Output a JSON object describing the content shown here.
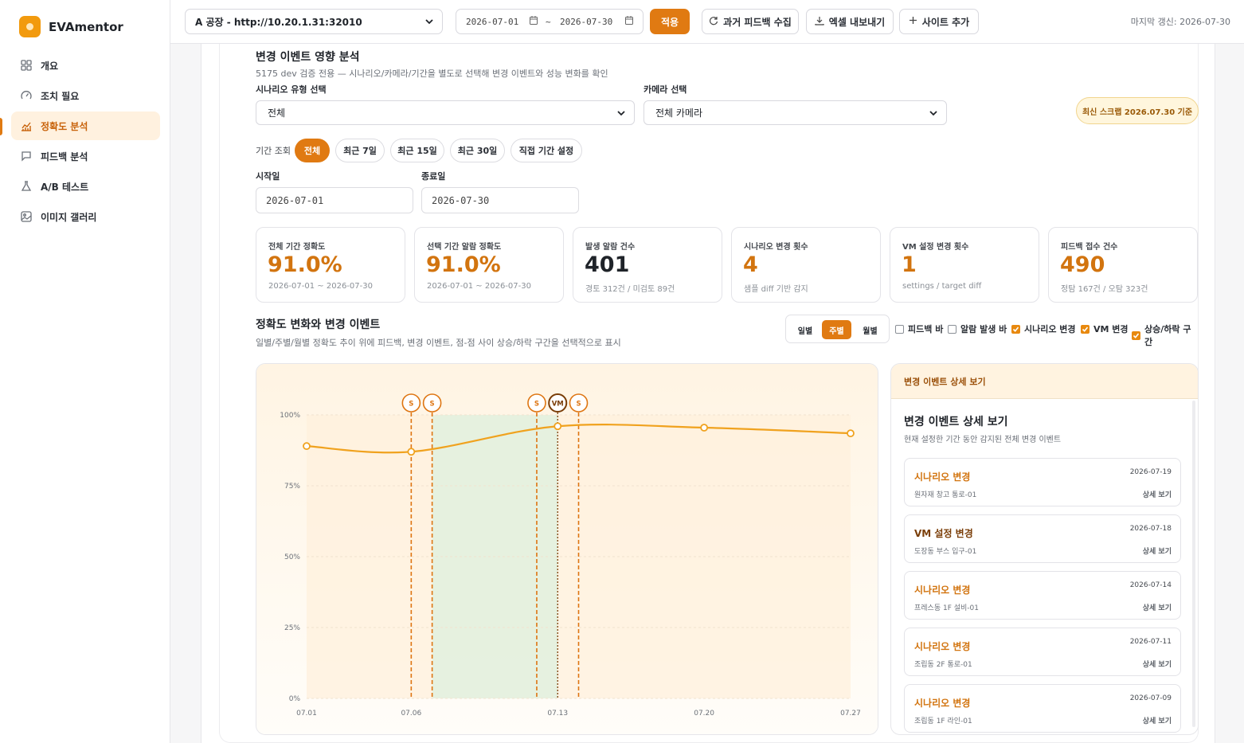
{
  "brand": {
    "name": "EVAmentor"
  },
  "nav": [
    {
      "label": "개요",
      "icon": "dashboard-icon"
    },
    {
      "label": "조치 필요",
      "icon": "gauge-icon"
    },
    {
      "label": "정확도 분석",
      "icon": "chart-icon",
      "active": true
    },
    {
      "label": "피드백 분석",
      "icon": "message-icon"
    },
    {
      "label": "A/B 테스트",
      "icon": "flask-icon"
    },
    {
      "label": "이미지 갤러리",
      "icon": "image-icon"
    }
  ],
  "topbar": {
    "site": "A 공장 - http://10.20.1.31:32010",
    "date_from": "2026-07-01",
    "date_sep": "~",
    "date_to": "2026-07-30",
    "apply": "적용",
    "collect": "과거 피드백 수집",
    "export": "엑셀 내보내기",
    "add_site": "사이트 추가",
    "updated": "마지막 갱신: 2026-07-30"
  },
  "impact": {
    "title": "변경 이벤트 영향 분석",
    "subtitle": "5175 dev 검증 전용 — 시나리오/카메라/기간을 별도로 선택해 변경 이벤트와 성능 변화를 확인",
    "scenario_label": "시나리오 유형 선택",
    "scenario_value": "전체",
    "camera_label": "카메라 선택",
    "camera_value": "전체 카메라",
    "scrap_badge": "최신 스크랩 2026.07.30 기준",
    "period_label": "기간 조회",
    "periods": [
      "전체",
      "최근 7일",
      "최근 15일",
      "최근 30일",
      "직접 기간 설정"
    ],
    "start_label": "시작일",
    "start_value": "2026-07-01",
    "end_label": "종료일",
    "end_value": "2026-07-30"
  },
  "kpis": [
    {
      "title": "전체 기간 정확도",
      "value": "91.0%",
      "sub": "2026-07-01 ~ 2026-07-30"
    },
    {
      "title": "선택 기간 알람 정확도",
      "value": "91.0%",
      "sub": "2026-07-01 ~ 2026-07-30"
    },
    {
      "title": "발생 알람 건수",
      "value": "401",
      "sub": "경토 312건 / 미검토 89건"
    },
    {
      "title": "시나리오 변경 횟수",
      "value": "4",
      "sub": "샘플 diff 기반 감지"
    },
    {
      "title": "VM 설정 변경 횟수",
      "value": "1",
      "sub": "settings / target diff"
    },
    {
      "title": "피드백 접수 건수",
      "value": "490",
      "sub": "정탐 167건 / 오탐 323건"
    }
  ],
  "trend": {
    "title": "정확도 변화와 변경 이벤트",
    "subtitle": "일별/주별/월별 정확도 추이 위에 피드백, 변경 이벤트, 점-점 사이 상승/하락 구간을 선택적으로 표시",
    "granularity": [
      "일별",
      "주별",
      "월별"
    ],
    "checks": [
      {
        "label": "피드백 바",
        "checked": false
      },
      {
        "label": "알람 발생 바",
        "checked": false
      },
      {
        "label": "시나리오 변경",
        "checked": true
      },
      {
        "label": "VM 변경",
        "checked": true
      },
      {
        "label": "상승/하락 구간",
        "checked": true
      }
    ]
  },
  "chart_data": {
    "type": "line",
    "x": [
      "07.01",
      "07.06",
      "07.13",
      "07.20",
      "07.27"
    ],
    "x_ticks": [
      "07.01",
      "07.06",
      "07.13",
      "07.20",
      "07.27"
    ],
    "series": [
      {
        "values": [
          89.0,
          87.0,
          96.0,
          95.5,
          93.5
        ]
      }
    ],
    "ylim": [
      0,
      100
    ],
    "y_ticks": [
      "0%",
      "25%",
      "50%",
      "75%",
      "100%"
    ],
    "events": [
      {
        "x": "07.06",
        "label": "S"
      },
      {
        "x": "07.07",
        "label": "S"
      },
      {
        "x": "07.12",
        "label": "S"
      },
      {
        "x": "07.13",
        "label": "VM"
      },
      {
        "x": "07.14",
        "label": "S"
      }
    ],
    "rise_band": [
      "07.07",
      "07.13"
    ],
    "colors": {
      "line": "#f0a21e",
      "event": "#de7512",
      "vm": "#7a3d07",
      "rise": "#e3f1df",
      "base": "#fff0dc"
    }
  },
  "detail": {
    "header": "변경 이벤트 상세 보기",
    "title": "변경 이벤트 상세 보기",
    "subtitle": "현재 설정한 기간 동안 감지된 전체 변경 이벤트",
    "action": "상세 보기",
    "events": [
      {
        "type": "시나리오 변경",
        "date": "2026-07-19",
        "location": "원자재 창고 통로-01"
      },
      {
        "type": "VM 설정 변경",
        "date": "2026-07-18",
        "location": "도장동 부스 입구-01"
      },
      {
        "type": "시나리오 변경",
        "date": "2026-07-14",
        "location": "프레스동 1F 설비-01"
      },
      {
        "type": "시나리오 변경",
        "date": "2026-07-11",
        "location": "조립동 2F 통로-01"
      },
      {
        "type": "시나리오 변경",
        "date": "2026-07-09",
        "location": "조립동 1F 라인-01"
      }
    ]
  }
}
